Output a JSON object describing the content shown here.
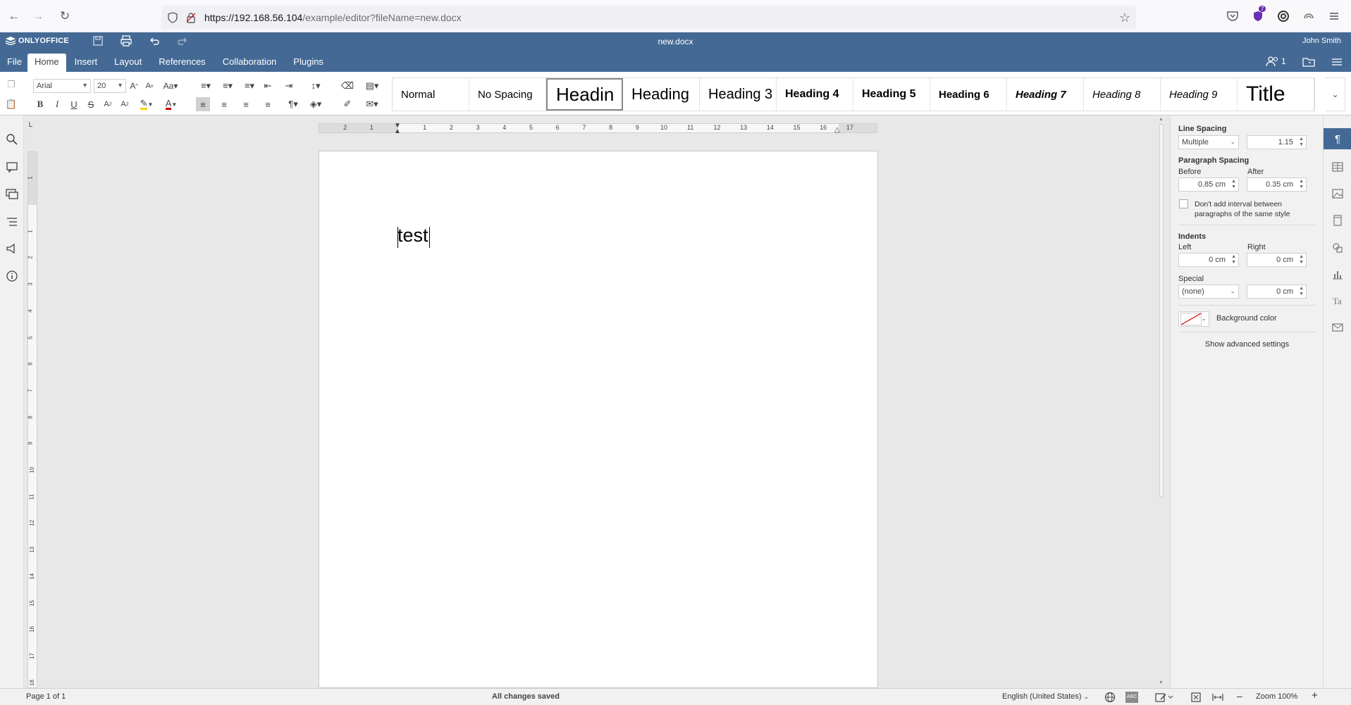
{
  "browser": {
    "url_host": "https://192.168.56.104",
    "url_path": "/example/editor?fileName=new.docx",
    "ext_badge": "7"
  },
  "header": {
    "logo": "ONLYOFFICE",
    "doc_title": "new.docx",
    "user_name": "John Smith",
    "users_count": "1",
    "tabs": [
      "File",
      "Home",
      "Insert",
      "Layout",
      "References",
      "Collaboration",
      "Plugins"
    ],
    "active_tab": "Home"
  },
  "toolbar": {
    "font_name": "Arial",
    "font_size": "20",
    "styles": [
      "Normal",
      "No Spacing",
      "Headin",
      "Heading",
      "Heading 3",
      "Heading 4",
      "Heading 5",
      "Heading 6",
      "Heading 7",
      "Heading 8",
      "Heading 9",
      "Title"
    ]
  },
  "document": {
    "text": "test"
  },
  "ruler": {
    "h_ticks": [
      "2",
      "1",
      "1",
      "2",
      "3",
      "4",
      "5",
      "6",
      "7",
      "8",
      "9",
      "10",
      "11",
      "12",
      "13",
      "14",
      "15",
      "16",
      "17"
    ],
    "v_ticks": [
      "1",
      "1",
      "2",
      "3",
      "4",
      "5",
      "6",
      "7",
      "8",
      "9",
      "10",
      "11",
      "12",
      "13",
      "14",
      "15",
      "16",
      "17",
      "18"
    ]
  },
  "panel": {
    "line_spacing_label": "Line Spacing",
    "line_spacing_type": "Multiple",
    "line_spacing_value": "1.15",
    "paragraph_spacing_label": "Paragraph Spacing",
    "before_label": "Before",
    "before_value": "0.85 cm",
    "after_label": "After",
    "after_value": "0.35 cm",
    "dont_add_label_1": "Don't add interval between",
    "dont_add_label_2": "paragraphs of the same style",
    "indents_label": "Indents",
    "left_label": "Left",
    "left_value": "0 cm",
    "right_label": "Right",
    "right_value": "0 cm",
    "special_label": "Special",
    "special_value": "(none)",
    "special_by_value": "0 cm",
    "background_color_label": "Background color",
    "advanced_link": "Show advanced settings"
  },
  "status": {
    "page_info": "Page 1 of 1",
    "save_status": "All changes saved",
    "language": "English (United States)",
    "zoom": "Zoom 100%"
  },
  "colors": {
    "header_bg": "#446995",
    "accent": "#446995"
  }
}
